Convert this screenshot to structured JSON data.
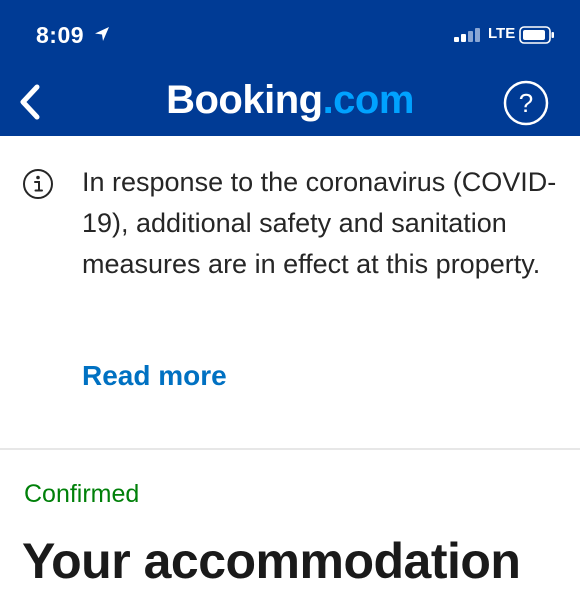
{
  "status_bar": {
    "time": "8:09",
    "network": "LTE"
  },
  "nav": {
    "brand_part1": "Booking",
    "brand_part2": ".com",
    "help_label": "?"
  },
  "notice": {
    "text": "In response to the coronavirus (COVID-19), additional safety and sanitation measures are in effect at this property.",
    "read_more": "Read more"
  },
  "booking": {
    "status": "Confirmed",
    "heading": "Your accommodation"
  },
  "colors": {
    "header_bg": "#003b95",
    "brand_accent": "#00a2ff",
    "link": "#0071c2",
    "confirmed": "#008009"
  },
  "icons": [
    "location-arrow-icon",
    "signal-icon",
    "battery-icon",
    "back-chevron-icon",
    "help-icon",
    "info-icon"
  ]
}
